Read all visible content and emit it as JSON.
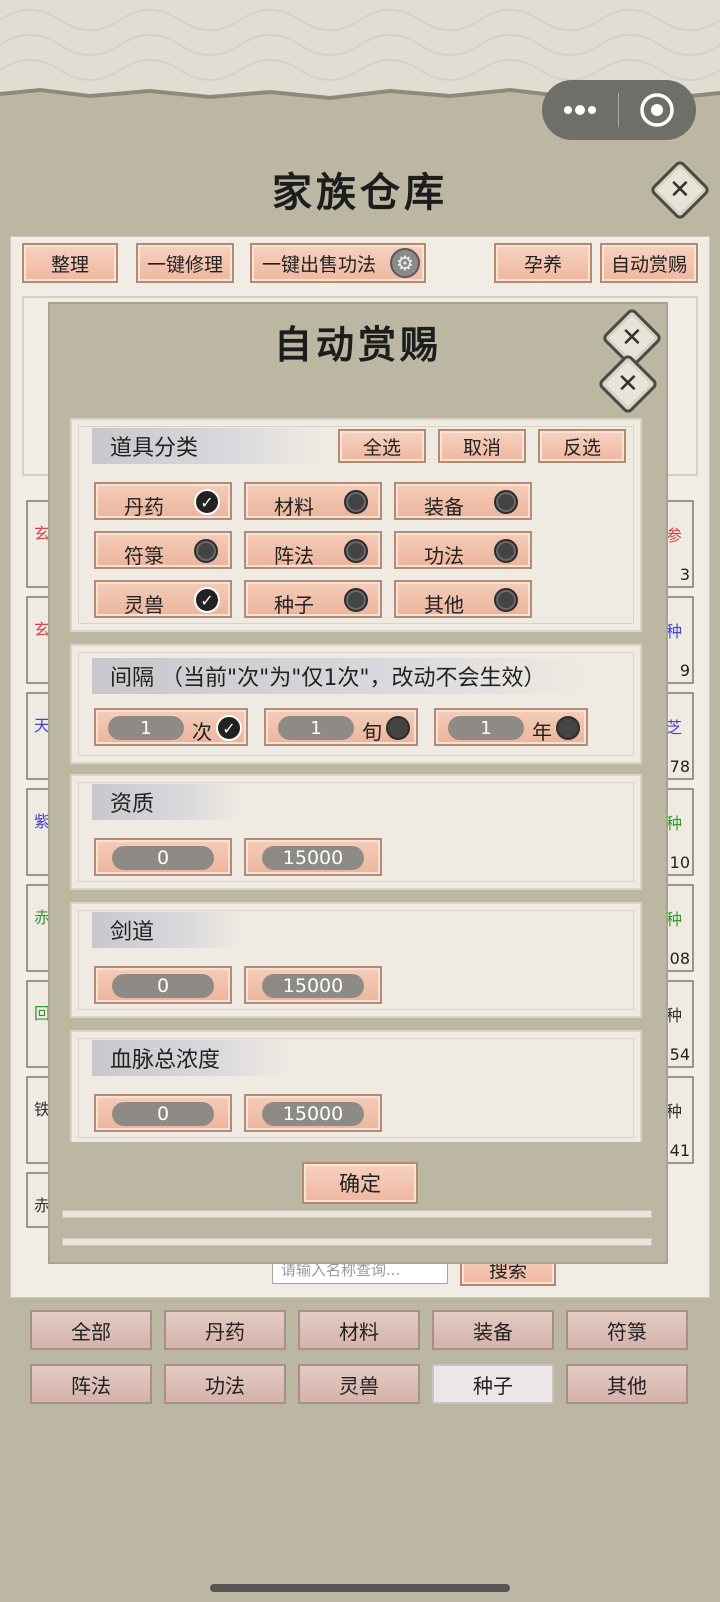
{
  "capsule": {
    "more_icon": "dots-icon",
    "close_icon": "target-icon"
  },
  "page_title": "家族仓库",
  "toolbar": {
    "tidy": "整理",
    "repair": "一键修理",
    "sell": "一键出售功法",
    "nurture": "孕养",
    "auto_reward": "自动赏赐"
  },
  "left_cards": [
    {
      "text": "玄",
      "color": "#d44"
    },
    {
      "text": "玄",
      "color": "#d44"
    },
    {
      "text": "天",
      "color": "#44c"
    },
    {
      "text": "紫",
      "color": "#44c"
    },
    {
      "text": "赤",
      "color": "#393"
    },
    {
      "text": "回",
      "color": "#393"
    },
    {
      "text": "铁",
      "color": "#333"
    },
    {
      "text": "赤",
      "color": "#333"
    }
  ],
  "right_cards": [
    {
      "text": "参",
      "count": "3",
      "color": "#d44"
    },
    {
      "text": "种",
      "count": "9",
      "color": "#44c"
    },
    {
      "text": "芝",
      "count": "78",
      "color": "#44c"
    },
    {
      "text": "种",
      "count": "10",
      "color": "#393"
    },
    {
      "text": "种",
      "count": "08",
      "color": "#393"
    },
    {
      "text": "种",
      "count": "54",
      "color": "#333"
    },
    {
      "text": "种",
      "count": "41",
      "color": "#333"
    }
  ],
  "search": {
    "placeholder": "请输入名称查询...",
    "button": "搜索"
  },
  "categories": [
    "全部",
    "丹药",
    "材料",
    "装备",
    "符箓",
    "阵法",
    "功法",
    "灵兽",
    "种子",
    "其他"
  ],
  "modal": {
    "title": "自动赏赐",
    "item_category": {
      "label": "道具分类",
      "select_all": "全选",
      "cancel": "取消",
      "invert": "反选",
      "items": [
        {
          "label": "丹药",
          "checked": true
        },
        {
          "label": "材料",
          "checked": false
        },
        {
          "label": "装备",
          "checked": false
        },
        {
          "label": "符箓",
          "checked": false
        },
        {
          "label": "阵法",
          "checked": false
        },
        {
          "label": "功法",
          "checked": false
        },
        {
          "label": "灵兽",
          "checked": true
        },
        {
          "label": "种子",
          "checked": false
        },
        {
          "label": "其他",
          "checked": false
        }
      ]
    },
    "interval": {
      "label": "间隔  （当前\"次\"为\"仅1次\"，改动不会生效）",
      "options": [
        {
          "value": "1",
          "unit": "次",
          "checked": true
        },
        {
          "value": "1",
          "unit": "旬",
          "checked": false
        },
        {
          "value": "1",
          "unit": "年",
          "checked": false
        }
      ]
    },
    "aptitude": {
      "label": "资质",
      "min": "0",
      "max": "15000"
    },
    "sword": {
      "label": "剑道",
      "min": "0",
      "max": "15000"
    },
    "bloodline": {
      "label": "血脉总浓度",
      "min": "0",
      "max": "15000"
    },
    "confirm": "确定"
  }
}
